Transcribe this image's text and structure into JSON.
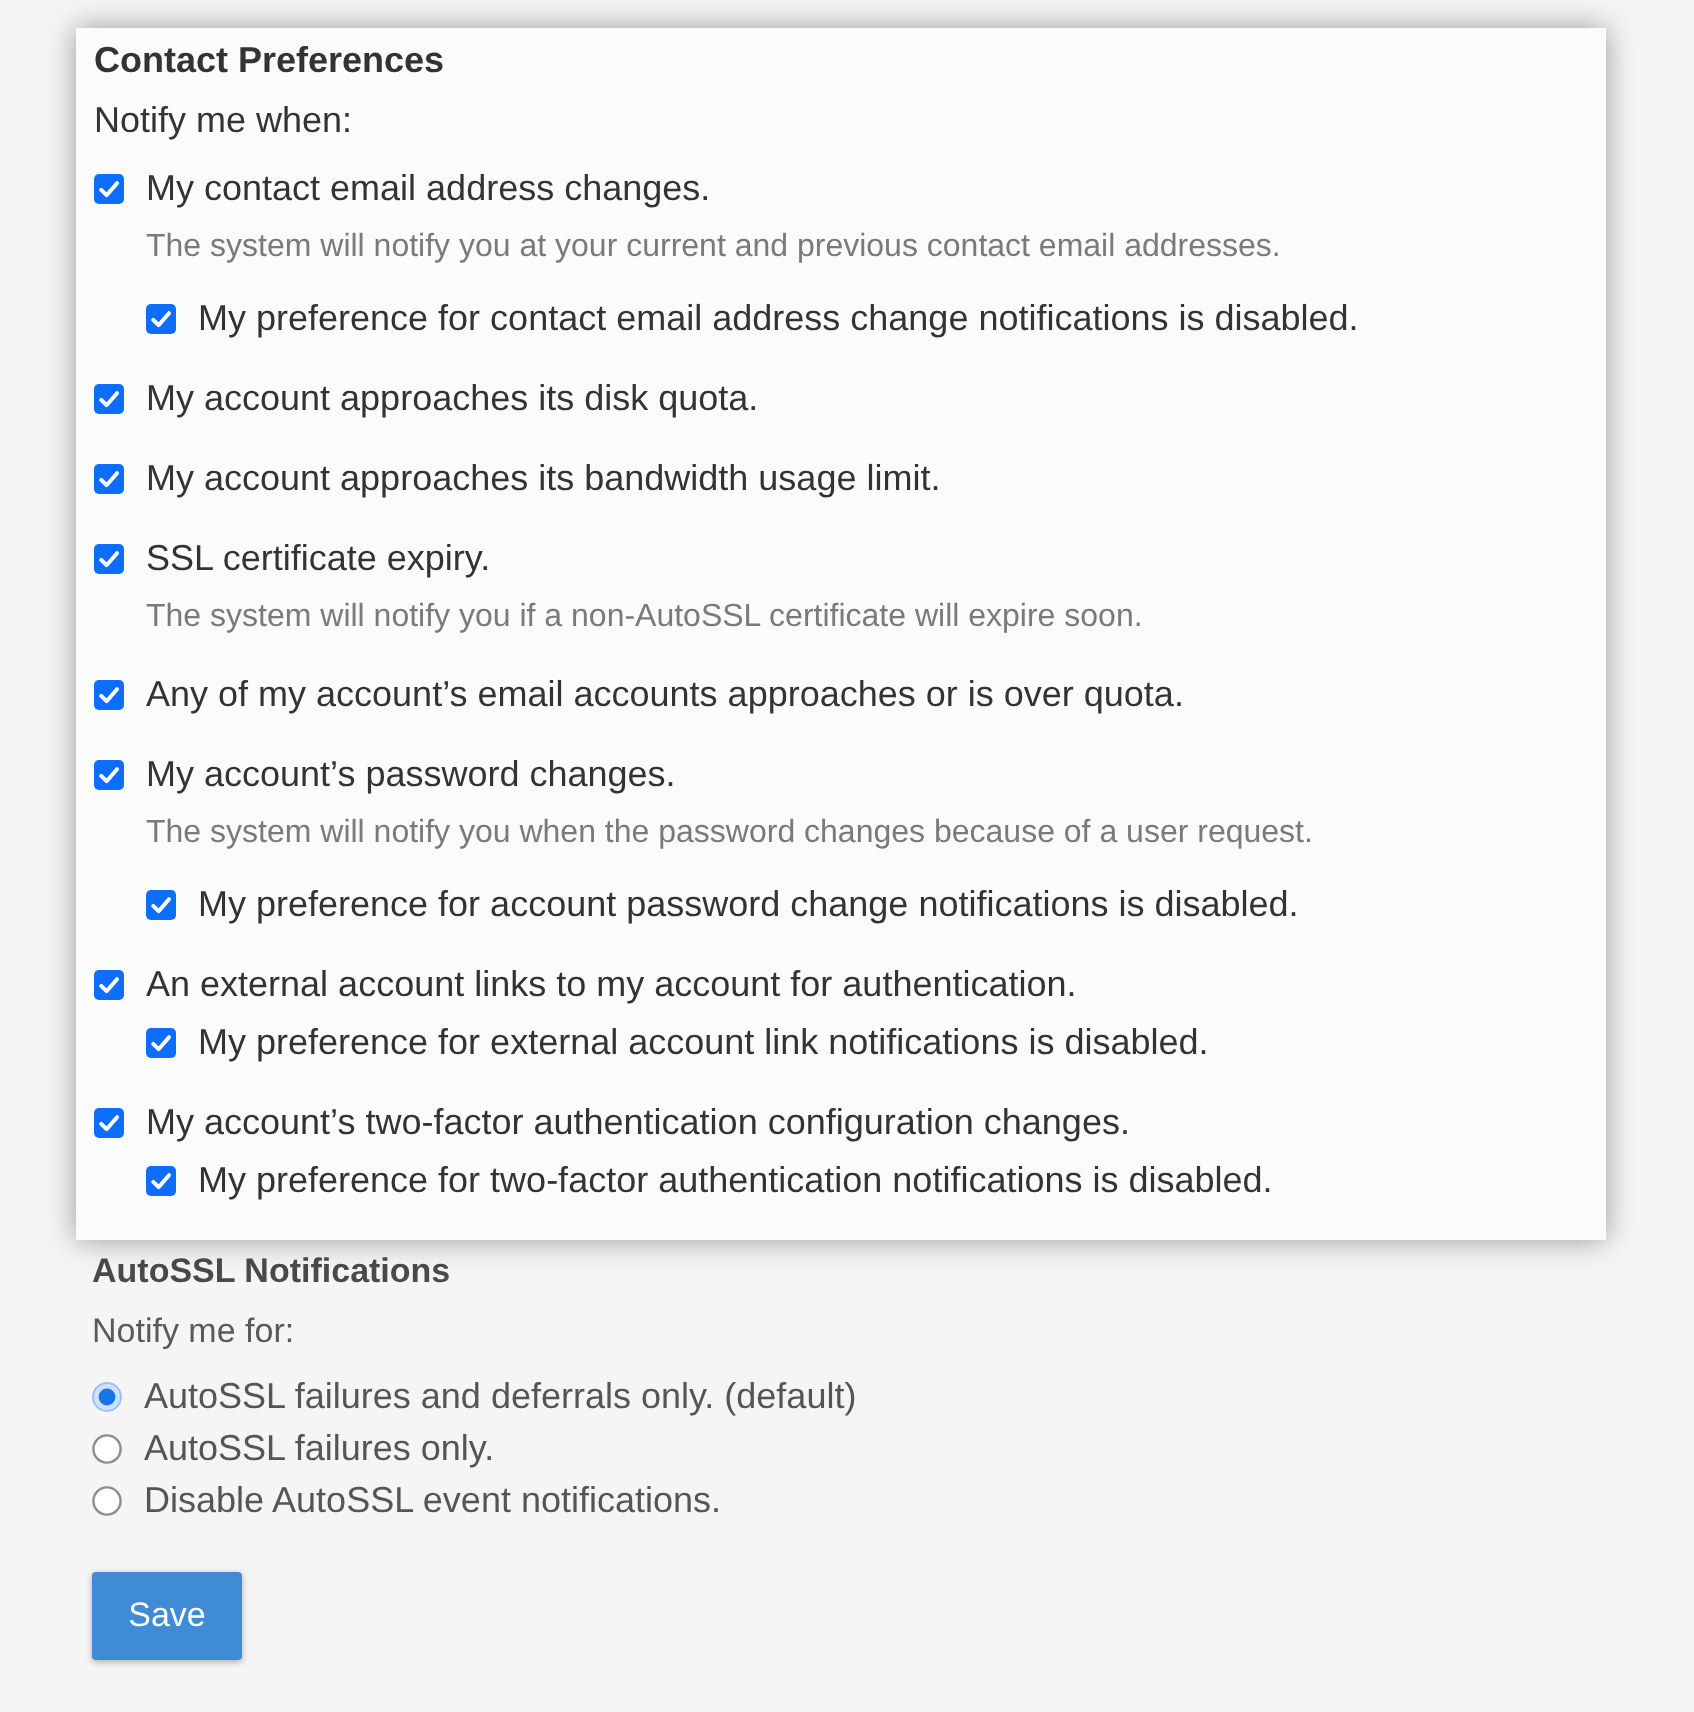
{
  "contact_preferences": {
    "title": "Contact Preferences",
    "intro": "Notify me when:",
    "options": [
      {
        "label": "My contact email address changes.",
        "checked": true,
        "description": "The system will notify you at your current and previous contact email addresses.",
        "children": [
          {
            "label": "My preference for contact email address change notifications is disabled.",
            "checked": true
          }
        ]
      },
      {
        "label": "My account approaches its disk quota.",
        "checked": true
      },
      {
        "label": "My account approaches its bandwidth usage limit.",
        "checked": true
      },
      {
        "label": "SSL certificate expiry.",
        "checked": true,
        "description": "The system will notify you if a non-AutoSSL certificate will expire soon."
      },
      {
        "label": "Any of my account’s email accounts approaches or is over quota.",
        "checked": true
      },
      {
        "label": "My account’s password changes.",
        "checked": true,
        "description": "The system will notify you when the password changes because of a user request.",
        "children": [
          {
            "label": "My preference for account password change notifications is disabled.",
            "checked": true
          }
        ]
      },
      {
        "label": "An external account links to my account for authentication.",
        "checked": true,
        "children": [
          {
            "label": "My preference for external account link notifications is disabled.",
            "checked": true
          }
        ]
      },
      {
        "label": "My account’s two-factor authentication configuration changes.",
        "checked": true,
        "children": [
          {
            "label": "My preference for two-factor authentication notifications is disabled.",
            "checked": true
          }
        ]
      }
    ]
  },
  "autossl_notifications": {
    "title": "AutoSSL Notifications",
    "intro": "Notify me for:",
    "options": [
      {
        "label": "AutoSSL failures and deferrals only. (default)",
        "selected": true
      },
      {
        "label": "AutoSSL failures only.",
        "selected": false
      },
      {
        "label": "Disable AutoSSL event notifications.",
        "selected": false
      }
    ]
  },
  "save_button": {
    "label": "Save"
  }
}
